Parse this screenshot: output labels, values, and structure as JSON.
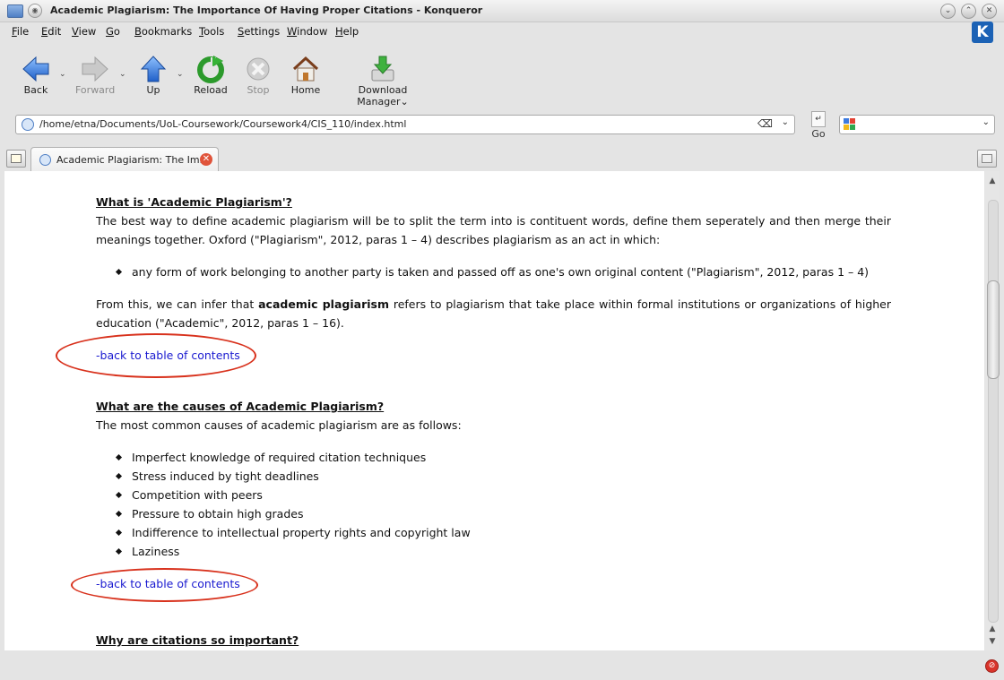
{
  "window": {
    "title": "Academic Plagiarism: The Importance Of Having Proper Citations - Konqueror",
    "menu_glyph": "◉",
    "controls": [
      "⌄",
      "⌃",
      "✕"
    ]
  },
  "menubar": {
    "items": [
      {
        "ul": "F",
        "rest": "ile"
      },
      {
        "ul": "E",
        "rest": "dit"
      },
      {
        "ul": "V",
        "rest": "iew"
      },
      {
        "ul": "G",
        "rest": "o"
      },
      {
        "ul": "B",
        "rest": "ookmarks"
      },
      {
        "ul": "T",
        "rest": "ools"
      },
      {
        "ul": "S",
        "rest": "ettings"
      },
      {
        "ul": "W",
        "rest": "indow"
      },
      {
        "ul": "H",
        "rest": "elp"
      }
    ],
    "logo": "K"
  },
  "toolbar": {
    "back": "Back",
    "forward": "Forward",
    "up": "Up",
    "reload": "Reload",
    "stop": "Stop",
    "home": "Home",
    "download_manager": "Download Manager",
    "dropdown_glyph": "⌄"
  },
  "location": {
    "url": "/home/etna/Documents/UoL-Coursework/Coursework4/CIS_110/index.html",
    "clear_glyph": "⌫",
    "dropdown_glyph": "⌄",
    "go_label": "Go",
    "go_glyph": "↵",
    "search_value": ""
  },
  "tabs": [
    {
      "label": "Academic Plagiarism: The Im...",
      "close": "✕"
    }
  ],
  "document": {
    "section1": {
      "heading": "What is 'Academic Plagiarism'?",
      "para1": "The best way to define academic plagiarism will be to split the term into is contituent words, define them seperately and then merge their meanings together. Oxford (\"Plagiarism\", 2012, paras 1 – 4) describes plagiarism as an act in which:",
      "bullets": [
        "any form of work belonging to another party is taken and passed off as one's own original content (\"Plagiarism\", 2012, paras 1 – 4)"
      ],
      "para2_before": "From this, we can infer that ",
      "para2_bold": "academic plagiarism",
      "para2_after": " refers to plagiarism that take place within formal institutions or organizations of higher education (\"Academic\", 2012, paras 1 – 16).",
      "back_link": "-back to table of contents"
    },
    "section2": {
      "heading": "What are the causes of Academic Plagiarism?",
      "intro": "The most common causes of academic plagiarism are as follows:",
      "bullets": [
        "Imperfect knowledge of required citation techniques",
        "Stress induced by tight deadlines",
        "Competition with peers",
        "Pressure to obtain high grades",
        "Indifference to intellectual property rights and copyright law",
        "Laziness"
      ],
      "back_link": "-back to table of contents"
    },
    "section3": {
      "heading": "Why are citations so important?"
    }
  },
  "scrollbar": {
    "up_glyph": "▲",
    "down_glyph": "▼"
  },
  "colors": {
    "link": "#1a1ad0",
    "annotation_ellipse": "#d8311c",
    "page_background": "#ffffff",
    "chrome_background": "#e4e4e4"
  },
  "status": {
    "icon_glyph": "⊘"
  }
}
